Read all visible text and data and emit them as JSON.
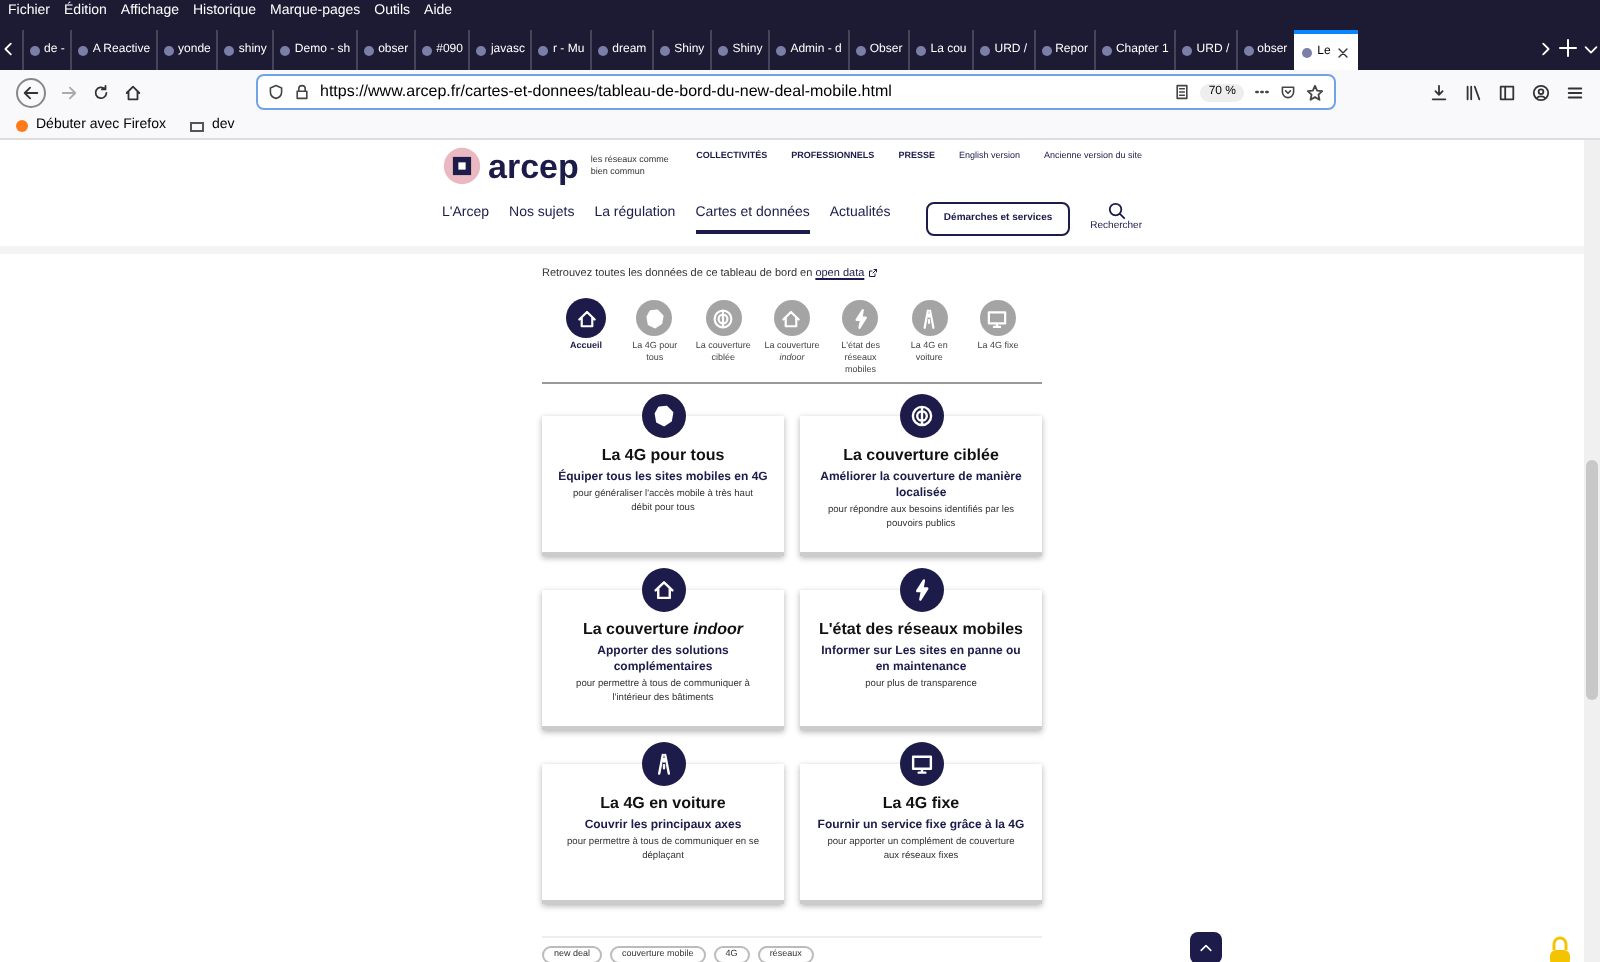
{
  "menu": [
    "Fichier",
    "Édition",
    "Affichage",
    "Historique",
    "Marque-pages",
    "Outils",
    "Aide"
  ],
  "tabs": [
    {
      "label": "de - ",
      "selected": false
    },
    {
      "label": "A Reactive",
      "selected": false
    },
    {
      "label": "yonde",
      "selected": false
    },
    {
      "label": "shiny",
      "selected": false
    },
    {
      "label": "Demo - sh",
      "selected": false
    },
    {
      "label": "obser",
      "selected": false
    },
    {
      "label": "#090",
      "selected": false
    },
    {
      "label": "javasc",
      "selected": false
    },
    {
      "label": "r - Mu",
      "selected": false
    },
    {
      "label": "dream",
      "selected": false
    },
    {
      "label": "Shiny",
      "selected": false
    },
    {
      "label": "Shiny",
      "selected": false
    },
    {
      "label": "Admin - d",
      "selected": false
    },
    {
      "label": "Obser",
      "selected": false
    },
    {
      "label": "La cou",
      "selected": false
    },
    {
      "label": "URD /",
      "selected": false
    },
    {
      "label": "Repor",
      "selected": false
    },
    {
      "label": "Chapter 1",
      "selected": false
    },
    {
      "label": "URD /",
      "selected": false
    },
    {
      "label": "obser",
      "selected": false
    },
    {
      "label": "Le",
      "selected": true
    }
  ],
  "address_bar": {
    "url": "https://www.arcep.fr/cartes-et-donnees/tableau-de-bord-du-new-deal-mobile.html",
    "zoom": "70 %"
  },
  "bookmarks": [
    "Débuter avec Firefox",
    "dev"
  ],
  "site": {
    "logo": "arcep",
    "tagline": "les réseaux comme bien commun",
    "top_links": [
      "COLLECTIVITÉS",
      "PROFESSIONNELS",
      "PRESSE",
      "English version",
      "Ancienne version du site"
    ],
    "nav": [
      {
        "label": "L'Arcep",
        "selected": false
      },
      {
        "label": "Nos sujets",
        "selected": false
      },
      {
        "label": "La régulation",
        "selected": false
      },
      {
        "label": "Cartes et données",
        "selected": true
      },
      {
        "label": "Actualités",
        "selected": false
      }
    ],
    "cta": "Démarches et services",
    "search": "Rechercher"
  },
  "intro": {
    "text": "Retrouvez toutes les données de ce tableau de bord en",
    "link": "open data"
  },
  "subnav": [
    {
      "label": "Accueil",
      "selected": true
    },
    {
      "label": "La 4G pour tous",
      "selected": false
    },
    {
      "label": "La couverture ciblée",
      "selected": false
    },
    {
      "label": "La couverture *indoor*",
      "selected": false
    },
    {
      "label": "L'état des réseaux mobiles",
      "selected": false
    },
    {
      "label": "La 4G en voiture",
      "selected": false
    },
    {
      "label": "La 4G fixe",
      "selected": false
    }
  ],
  "cards": [
    {
      "title": "La 4G pour tous",
      "subtitle": "Équiper tous les sites mobiles en 4G",
      "description": "pour généraliser l'accès mobile à très haut débit pour tous"
    },
    {
      "title": "La couverture ciblée",
      "subtitle": "Améliorer la couverture de manière localisée",
      "description": "pour répondre aux besoins identifiés par les pouvoirs publics"
    },
    {
      "title": "La couverture *indoor*",
      "subtitle": "Apporter des solutions complémentaires",
      "description": "pour permettre à tous de communiquer à l'intérieur des bâtiments"
    },
    {
      "title": "L'état des réseaux mobiles",
      "subtitle": "Informer sur Les sites en panne ou en maintenance",
      "description": "pour plus de transparence"
    },
    {
      "title": "La 4G en voiture",
      "subtitle": "Couvrir les principaux axes",
      "description": "pour permettre à tous de communiquer en se déplaçant"
    },
    {
      "title": "La 4G fixe",
      "subtitle": "Fournir un service fixe grâce à la 4G",
      "description": "pour apporter un complément de couverture aux réseaux fixes"
    }
  ],
  "tags": [
    "new deal",
    "couverture mobile",
    "4G",
    "réseaux"
  ]
}
